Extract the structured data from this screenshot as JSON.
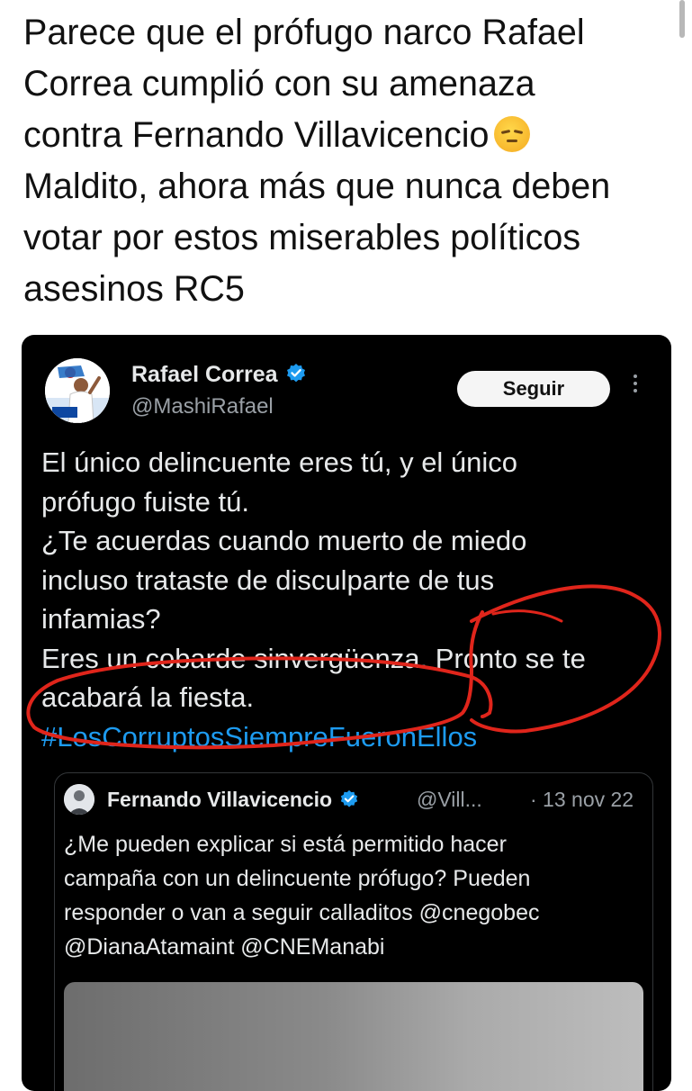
{
  "post": {
    "lines": [
      "Parece que el prófugo narco Rafael",
      "Correa cumplió con su amenaza",
      "contra Fernando Villavicencio",
      "Maldito, ahora más que nunca deben",
      "votar por estos miserables políticos",
      "asesinos RC5"
    ],
    "emoji": "pensive-face-emoji"
  },
  "tweet": {
    "author_name": "Rafael Correa",
    "handle": "@MashiRafael",
    "follow_label": "Seguir",
    "body_lines": [
      "El único delincuente eres tú, y el único",
      "prófugo fuiste tú.",
      "¿Te acuerdas cuando muerto de miedo",
      "incluso trataste de disculparte de tus",
      "infamias?",
      "Eres un cobarde sinvergüenza. Pronto se te",
      "acabará la fiesta."
    ],
    "hashtag": "#LosCorruptosSiempreFueronEllos",
    "annotation_color": "#e0251b"
  },
  "quoted": {
    "author_name": "Fernando Villavicencio",
    "handle": "@Vill...",
    "date": "· 13 nov 22",
    "body_lines": [
      "¿Me pueden explicar si está permitido hacer",
      "campaña con un delincuente prófugo? Pueden",
      "responder o van a seguir calladitos @cnegobec",
      "@DianaAtamaint @CNEManabi"
    ]
  },
  "colors": {
    "link": "#1d9bf0",
    "verified": "#1d9bf0",
    "card_bg": "#000000"
  }
}
